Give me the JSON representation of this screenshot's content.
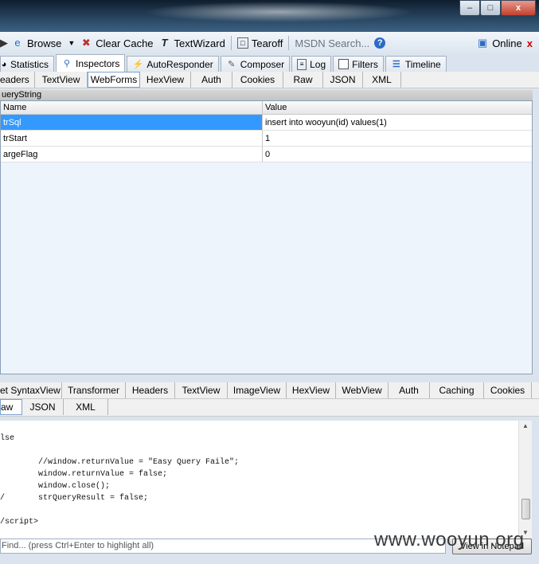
{
  "window": {
    "min": "–",
    "max": "□",
    "close": "x"
  },
  "toolbar": {
    "browse": "Browse",
    "clear_cache": "Clear Cache",
    "textwizard": "TextWizard",
    "tearoff": "Tearoff",
    "search_placeholder": "MSDN Search...",
    "online": "Online",
    "close_x": "x"
  },
  "main_tabs": [
    "Statistics",
    "Inspectors",
    "AutoResponder",
    "Composer",
    "Log",
    "Filters",
    "Timeline"
  ],
  "request_tabs": [
    "eaders",
    "TextView",
    "WebForms",
    "HexView",
    "Auth",
    "Cookies",
    "Raw",
    "JSON",
    "XML"
  ],
  "querystring": {
    "header": "ueryString",
    "col_name": "Name",
    "col_value": "Value",
    "rows": [
      {
        "name": "trSql",
        "value": "insert into wooyun(id) values(1)"
      },
      {
        "name": "trStart",
        "value": "1"
      },
      {
        "name": "argeFlag",
        "value": "0"
      }
    ]
  },
  "response_tabs_row1": [
    "et SyntaxView",
    "Transformer",
    "Headers",
    "TextView",
    "ImageView",
    "HexView",
    "WebView",
    "Auth",
    "Caching",
    "Cookies"
  ],
  "response_tabs_row2": [
    "aw",
    "JSON",
    "XML"
  ],
  "code_lines": [
    "lse",
    "",
    "        //window.returnValue = \"Easy Query Faile\";",
    "        window.returnValue = false;",
    "        window.close();",
    "/       strQueryResult = false;",
    "",
    "/script>"
  ],
  "find_placeholder": "Find... (press Ctrl+Enter to highlight all)",
  "notepad_button": "View in Notepad",
  "watermark": "www.wooyun.org"
}
